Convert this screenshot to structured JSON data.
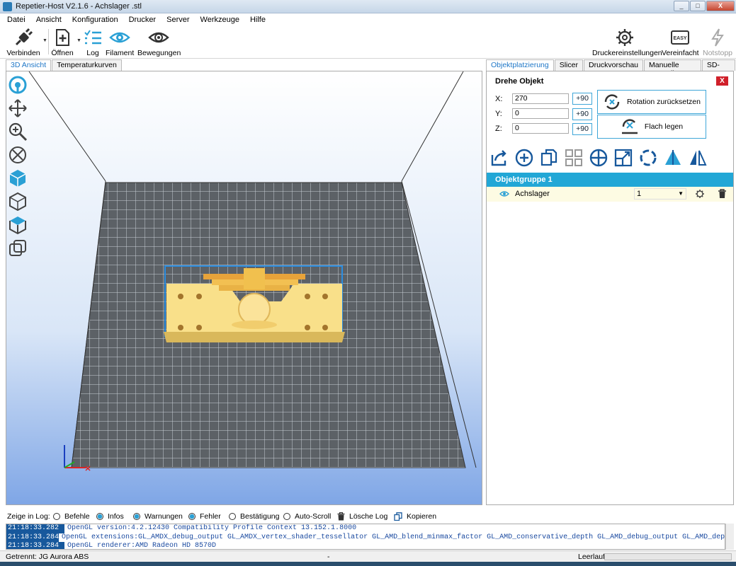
{
  "window": {
    "title": "Repetier-Host V2.1.6 - Achslager .stl",
    "min": "_",
    "max": "□",
    "close": "X"
  },
  "menu": [
    "Datei",
    "Ansicht",
    "Konfiguration",
    "Drucker",
    "Server",
    "Werkzeuge",
    "Hilfe"
  ],
  "toolbar": {
    "connect": "Verbinden",
    "open": "Öffnen",
    "log": "Log",
    "filament": "Filament",
    "moves": "Bewegungen",
    "printer_settings": "Druckereinstellungen",
    "simplified": "Vereinfacht",
    "easy_badge": "EASY",
    "emergency": "Notstopp"
  },
  "left_tabs": [
    "3D Ansicht",
    "Temperaturkurven"
  ],
  "right_tabs": [
    "Objektplatzierung",
    "Slicer",
    "Druckvorschau",
    "Manuelle Kontrolle",
    "SD-Karte"
  ],
  "rotate": {
    "title": "Drehe Objekt",
    "close": "X",
    "x_label": "X:",
    "x_value": "270",
    "y_label": "Y:",
    "y_value": "0",
    "z_label": "Z:",
    "z_value": "0",
    "plus90": "+90",
    "reset_rotation": "Rotation zurücksetzen",
    "lay_flat": "Flach legen"
  },
  "objects": {
    "group": "Objektgruppe 1",
    "items": [
      {
        "name": "Achslager",
        "count": "1"
      }
    ]
  },
  "log": {
    "show_label": "Zeige in Log:",
    "filters": [
      {
        "label": "Befehle",
        "checked": false
      },
      {
        "label": "Infos",
        "checked": true
      },
      {
        "label": "Warnungen",
        "checked": true
      },
      {
        "label": "Fehler",
        "checked": true
      },
      {
        "label": "Bestätigung",
        "checked": false
      },
      {
        "label": "Auto-Scroll",
        "checked": false
      }
    ],
    "clear": "Lösche Log",
    "copy": "Kopieren",
    "lines": [
      {
        "time": "21:18:33.282",
        "msg": "OpenGL version:4.2.12430 Compatibility Profile Context 13.152.1.8000"
      },
      {
        "time": "21:18:33.284",
        "msg": "OpenGL extensions:GL_AMDX_debug_output GL_AMDX_vertex_shader_tessellator GL_AMD_blend_minmax_factor GL_AMD_conservative_depth GL_AMD_debug_output GL_AMD_dep"
      },
      {
        "time": "21:18:33.284",
        "msg": "OpenGL renderer:AMD Radeon HD 8570D"
      }
    ]
  },
  "status": {
    "connection": "Getrennt: JG Aurora ABS",
    "middle": "-",
    "idle": "Leerlauf"
  },
  "colors": {
    "accent": "#22a7d6",
    "model": "#f5d67a",
    "selection": "#2b8de0"
  }
}
